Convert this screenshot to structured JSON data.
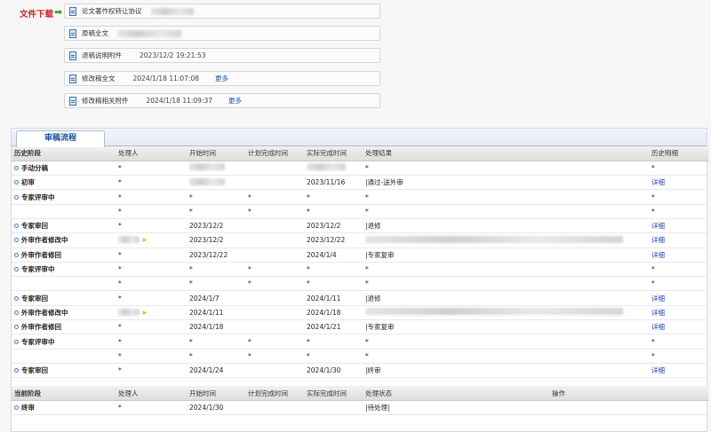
{
  "downloads": {
    "label": "文件下载",
    "arrow": "➡",
    "files": [
      {
        "name": "论文著作权转让协议",
        "date": "",
        "more": ""
      },
      {
        "name": "原稿全文",
        "date": "",
        "more": ""
      },
      {
        "name": "退稿说明附件",
        "date": "2023/12/2 19:21:53",
        "more": ""
      },
      {
        "name": "修改稿全文",
        "date": "2024/1/18 11:07:08",
        "more": "更多"
      },
      {
        "name": "修改稿相关附件",
        "date": "2024/1/18 11:09:37",
        "more": "更多"
      }
    ]
  },
  "tab": {
    "label": "审稿流程"
  },
  "history": {
    "headers": [
      "历史阶段",
      "处理人",
      "开始时间",
      "计划完成时间",
      "实际完成时间",
      "处理结果",
      "历史明细"
    ],
    "rows": [
      {
        "stage": "手动分稿",
        "handler": "*",
        "start": "",
        "plan": "",
        "actual": "",
        "result": "*",
        "detail": "*",
        "blur_start": true,
        "blur_actual": true
      },
      {
        "stage": "初审",
        "handler": "*",
        "start": "",
        "plan": "",
        "actual": "2023/11/16",
        "result": "|通过-送外审",
        "detail": "详细",
        "blur_start": true
      },
      {
        "stage": "专家评审中",
        "handler": "*",
        "start": "*",
        "plan": "*",
        "actual": "*",
        "result": "*",
        "detail": "*"
      },
      {
        "stage": "",
        "handler": "*",
        "start": "*",
        "plan": "*",
        "actual": "*",
        "result": "*",
        "detail": "*"
      },
      {
        "stage": "专家审回",
        "handler": "*",
        "start": "2023/12/2",
        "plan": "",
        "actual": "2023/12/2",
        "result": "|退修",
        "detail": "详细"
      },
      {
        "stage": "外审作者修改中",
        "handler": "",
        "start": "2023/12/2",
        "plan": "",
        "actual": "2023/12/22",
        "result": "",
        "detail": "详细",
        "blur_handler": true,
        "blur_result": true
      },
      {
        "stage": "外审作者修回",
        "handler": "*",
        "start": "2023/12/22",
        "plan": "",
        "actual": "2024/1/4",
        "result": "|专家复审",
        "detail": "详细"
      },
      {
        "stage": "专家评审中",
        "handler": "*",
        "start": "*",
        "plan": "*",
        "actual": "*",
        "result": "*",
        "detail": "*"
      },
      {
        "stage": "",
        "handler": "*",
        "start": "*",
        "plan": "*",
        "actual": "*",
        "result": "*",
        "detail": "*"
      },
      {
        "stage": "专家审回",
        "handler": "*",
        "start": "2024/1/7",
        "plan": "",
        "actual": "2024/1/11",
        "result": "|退修",
        "detail": "详细"
      },
      {
        "stage": "外审作者修改中",
        "handler": "",
        "start": "2024/1/11",
        "plan": "",
        "actual": "2024/1/18",
        "result": "",
        "detail": "详细",
        "blur_handler": true,
        "blur_result": true
      },
      {
        "stage": "外审作者修回",
        "handler": "*",
        "start": "2024/1/18",
        "plan": "",
        "actual": "2024/1/21",
        "result": "|专家复审",
        "detail": "详细"
      },
      {
        "stage": "专家评审中",
        "handler": "*",
        "start": "*",
        "plan": "*",
        "actual": "*",
        "result": "*",
        "detail": "*"
      },
      {
        "stage": "",
        "handler": "*",
        "start": "*",
        "plan": "*",
        "actual": "*",
        "result": "*",
        "detail": "*"
      },
      {
        "stage": "专家审回",
        "handler": "*",
        "start": "2024/1/24",
        "plan": "",
        "actual": "2024/1/30",
        "result": "|终审",
        "detail": "详细"
      }
    ]
  },
  "current": {
    "headers": [
      "当前阶段",
      "处理人",
      "开始时间",
      "计划完成时间",
      "实际完成时间",
      "处理状态",
      "操作"
    ],
    "rows": [
      {
        "stage": "终审",
        "handler": "*",
        "start": "2024/1/30",
        "plan": "",
        "actual": "",
        "status": "|待处理|",
        "op": ""
      }
    ]
  },
  "colors": {
    "accent": "#1c4fa0",
    "download_label": "#cc1f1f",
    "link": "#1a3fa8"
  }
}
